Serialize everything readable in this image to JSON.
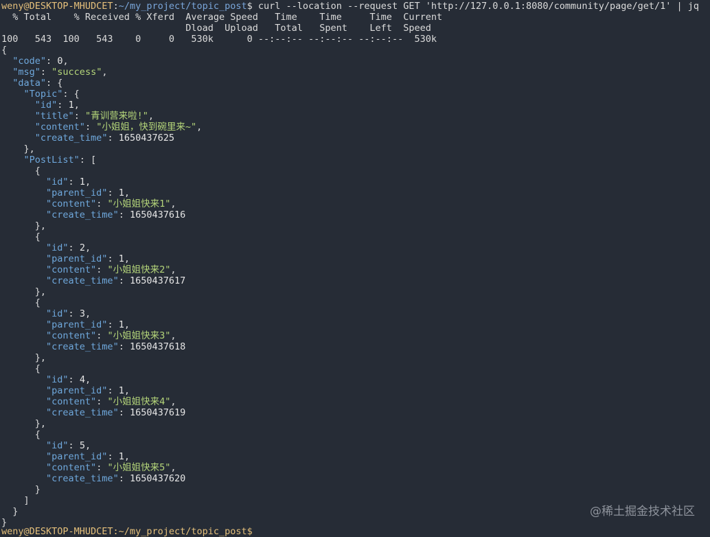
{
  "prompt": {
    "user_host": "weny@DESKTOP-MHUDCET",
    "path": "~/my_project/topic_post",
    "symbol": "$",
    "command": " curl --location --request GET 'http://127.0.0.1:8080/community/page/get/1' | jq"
  },
  "curl_progress": {
    "header1": "  % Total    % Received % Xferd  Average Speed   Time    Time     Time  Current",
    "header2": "                                 Dload  Upload   Total   Spent    Left  Speed",
    "row": "100   543  100   543    0     0   530k      0 --:--:-- --:--:-- --:--:--  530k"
  },
  "json_lines": [
    {
      "indent": 0,
      "parts": [
        [
          "p",
          "{"
        ]
      ]
    },
    {
      "indent": 1,
      "parts": [
        [
          "k",
          "\"code\""
        ],
        [
          "p",
          ": "
        ],
        [
          "n",
          "0"
        ],
        [
          "p",
          ","
        ]
      ]
    },
    {
      "indent": 1,
      "parts": [
        [
          "k",
          "\"msg\""
        ],
        [
          "p",
          ": "
        ],
        [
          "s",
          "\"success\""
        ],
        [
          "p",
          ","
        ]
      ]
    },
    {
      "indent": 1,
      "parts": [
        [
          "k",
          "\"data\""
        ],
        [
          "p",
          ": {"
        ]
      ]
    },
    {
      "indent": 2,
      "parts": [
        [
          "k",
          "\"Topic\""
        ],
        [
          "p",
          ": {"
        ]
      ]
    },
    {
      "indent": 3,
      "parts": [
        [
          "k",
          "\"id\""
        ],
        [
          "p",
          ": "
        ],
        [
          "n",
          "1"
        ],
        [
          "p",
          ","
        ]
      ]
    },
    {
      "indent": 3,
      "parts": [
        [
          "k",
          "\"title\""
        ],
        [
          "p",
          ": "
        ],
        [
          "s",
          "\"青训营来啦!\""
        ],
        [
          "p",
          ","
        ]
      ]
    },
    {
      "indent": 3,
      "parts": [
        [
          "k",
          "\"content\""
        ],
        [
          "p",
          ": "
        ],
        [
          "s",
          "\"小姐姐，快到碗里来~\""
        ],
        [
          "p",
          ","
        ]
      ]
    },
    {
      "indent": 3,
      "parts": [
        [
          "k",
          "\"create_time\""
        ],
        [
          "p",
          ": "
        ],
        [
          "n",
          "1650437625"
        ]
      ]
    },
    {
      "indent": 2,
      "parts": [
        [
          "p",
          "},"
        ]
      ]
    },
    {
      "indent": 2,
      "parts": [
        [
          "k",
          "\"PostList\""
        ],
        [
          "p",
          ": ["
        ]
      ]
    },
    {
      "indent": 3,
      "parts": [
        [
          "p",
          "{"
        ]
      ]
    },
    {
      "indent": 4,
      "parts": [
        [
          "k",
          "\"id\""
        ],
        [
          "p",
          ": "
        ],
        [
          "n",
          "1"
        ],
        [
          "p",
          ","
        ]
      ]
    },
    {
      "indent": 4,
      "parts": [
        [
          "k",
          "\"parent_id\""
        ],
        [
          "p",
          ": "
        ],
        [
          "n",
          "1"
        ],
        [
          "p",
          ","
        ]
      ]
    },
    {
      "indent": 4,
      "parts": [
        [
          "k",
          "\"content\""
        ],
        [
          "p",
          ": "
        ],
        [
          "s",
          "\"小姐姐快来1\""
        ],
        [
          "p",
          ","
        ]
      ]
    },
    {
      "indent": 4,
      "parts": [
        [
          "k",
          "\"create_time\""
        ],
        [
          "p",
          ": "
        ],
        [
          "n",
          "1650437616"
        ]
      ]
    },
    {
      "indent": 3,
      "parts": [
        [
          "p",
          "},"
        ]
      ]
    },
    {
      "indent": 3,
      "parts": [
        [
          "p",
          "{"
        ]
      ]
    },
    {
      "indent": 4,
      "parts": [
        [
          "k",
          "\"id\""
        ],
        [
          "p",
          ": "
        ],
        [
          "n",
          "2"
        ],
        [
          "p",
          ","
        ]
      ]
    },
    {
      "indent": 4,
      "parts": [
        [
          "k",
          "\"parent_id\""
        ],
        [
          "p",
          ": "
        ],
        [
          "n",
          "1"
        ],
        [
          "p",
          ","
        ]
      ]
    },
    {
      "indent": 4,
      "parts": [
        [
          "k",
          "\"content\""
        ],
        [
          "p",
          ": "
        ],
        [
          "s",
          "\"小姐姐快来2\""
        ],
        [
          "p",
          ","
        ]
      ]
    },
    {
      "indent": 4,
      "parts": [
        [
          "k",
          "\"create_time\""
        ],
        [
          "p",
          ": "
        ],
        [
          "n",
          "1650437617"
        ]
      ]
    },
    {
      "indent": 3,
      "parts": [
        [
          "p",
          "},"
        ]
      ]
    },
    {
      "indent": 3,
      "parts": [
        [
          "p",
          "{"
        ]
      ]
    },
    {
      "indent": 4,
      "parts": [
        [
          "k",
          "\"id\""
        ],
        [
          "p",
          ": "
        ],
        [
          "n",
          "3"
        ],
        [
          "p",
          ","
        ]
      ]
    },
    {
      "indent": 4,
      "parts": [
        [
          "k",
          "\"parent_id\""
        ],
        [
          "p",
          ": "
        ],
        [
          "n",
          "1"
        ],
        [
          "p",
          ","
        ]
      ]
    },
    {
      "indent": 4,
      "parts": [
        [
          "k",
          "\"content\""
        ],
        [
          "p",
          ": "
        ],
        [
          "s",
          "\"小姐姐快来3\""
        ],
        [
          "p",
          ","
        ]
      ]
    },
    {
      "indent": 4,
      "parts": [
        [
          "k",
          "\"create_time\""
        ],
        [
          "p",
          ": "
        ],
        [
          "n",
          "1650437618"
        ]
      ]
    },
    {
      "indent": 3,
      "parts": [
        [
          "p",
          "},"
        ]
      ]
    },
    {
      "indent": 3,
      "parts": [
        [
          "p",
          "{"
        ]
      ]
    },
    {
      "indent": 4,
      "parts": [
        [
          "k",
          "\"id\""
        ],
        [
          "p",
          ": "
        ],
        [
          "n",
          "4"
        ],
        [
          "p",
          ","
        ]
      ]
    },
    {
      "indent": 4,
      "parts": [
        [
          "k",
          "\"parent_id\""
        ],
        [
          "p",
          ": "
        ],
        [
          "n",
          "1"
        ],
        [
          "p",
          ","
        ]
      ]
    },
    {
      "indent": 4,
      "parts": [
        [
          "k",
          "\"content\""
        ],
        [
          "p",
          ": "
        ],
        [
          "s",
          "\"小姐姐快来4\""
        ],
        [
          "p",
          ","
        ]
      ]
    },
    {
      "indent": 4,
      "parts": [
        [
          "k",
          "\"create_time\""
        ],
        [
          "p",
          ": "
        ],
        [
          "n",
          "1650437619"
        ]
      ]
    },
    {
      "indent": 3,
      "parts": [
        [
          "p",
          "},"
        ]
      ]
    },
    {
      "indent": 3,
      "parts": [
        [
          "p",
          "{"
        ]
      ]
    },
    {
      "indent": 4,
      "parts": [
        [
          "k",
          "\"id\""
        ],
        [
          "p",
          ": "
        ],
        [
          "n",
          "5"
        ],
        [
          "p",
          ","
        ]
      ]
    },
    {
      "indent": 4,
      "parts": [
        [
          "k",
          "\"parent_id\""
        ],
        [
          "p",
          ": "
        ],
        [
          "n",
          "1"
        ],
        [
          "p",
          ","
        ]
      ]
    },
    {
      "indent": 4,
      "parts": [
        [
          "k",
          "\"content\""
        ],
        [
          "p",
          ": "
        ],
        [
          "s",
          "\"小姐姐快来5\""
        ],
        [
          "p",
          ","
        ]
      ]
    },
    {
      "indent": 4,
      "parts": [
        [
          "k",
          "\"create_time\""
        ],
        [
          "p",
          ": "
        ],
        [
          "n",
          "1650437620"
        ]
      ]
    },
    {
      "indent": 3,
      "parts": [
        [
          "p",
          "}"
        ]
      ]
    },
    {
      "indent": 2,
      "parts": [
        [
          "p",
          "]"
        ]
      ]
    },
    {
      "indent": 1,
      "parts": [
        [
          "p",
          "}"
        ]
      ]
    },
    {
      "indent": 0,
      "parts": [
        [
          "p",
          "}"
        ]
      ]
    }
  ],
  "next_prompt": "weny@DESKTOP-MHUDCET:~/my_project/topic_post$",
  "watermark": "@稀土掘金技术社区",
  "colors": {
    "background": "#262c36",
    "json_key": "#6fa8dc",
    "json_string": "#b5d67a",
    "prompt_user": "#e5c07b",
    "prompt_path": "#7aa6da"
  }
}
